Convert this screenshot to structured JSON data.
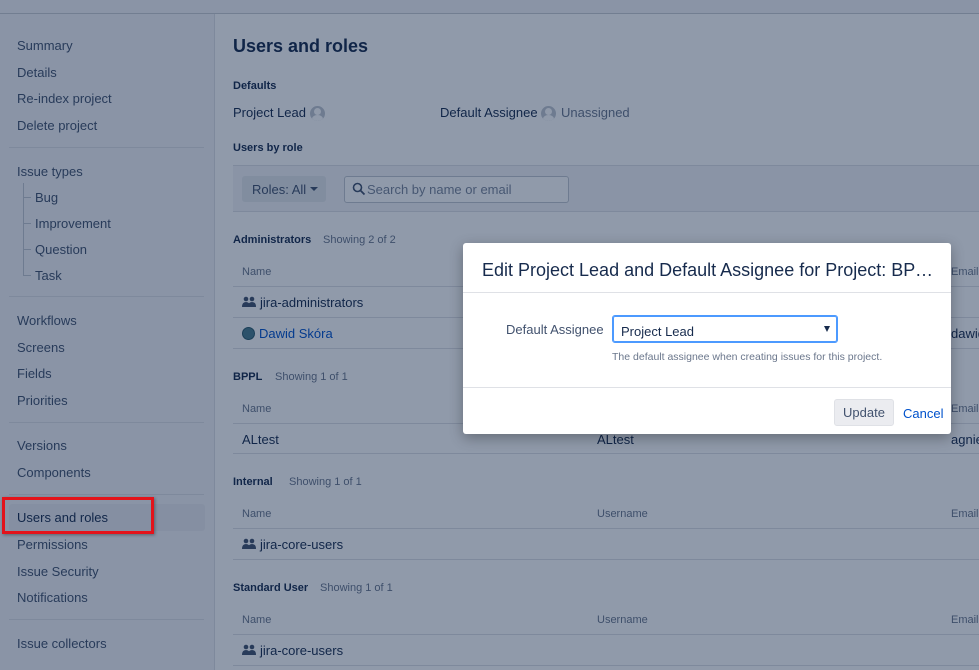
{
  "sidebar": {
    "project_items": [
      "Summary",
      "Details",
      "Re-index project",
      "Delete project"
    ],
    "issue_types_label": "Issue types",
    "issue_types": [
      "Bug",
      "Improvement",
      "Question",
      "Task"
    ],
    "workflow_items": [
      "Workflows",
      "Screens",
      "Fields",
      "Priorities"
    ],
    "version_items": [
      "Versions",
      "Components"
    ],
    "access_items": [
      "Users and roles",
      "Permissions",
      "Issue Security",
      "Notifications"
    ],
    "collector_items": [
      "Issue collectors"
    ],
    "selected": "Users and roles"
  },
  "main": {
    "title": "Users and roles",
    "defaults_heading": "Defaults",
    "project_lead_label": "Project Lead",
    "default_assignee_label": "Default Assignee",
    "default_assignee_value": "Unassigned",
    "users_by_role_heading": "Users by role",
    "roles_button": "Roles: All",
    "search_placeholder": "Search by name or email"
  },
  "sections": [
    {
      "name": "Administrators",
      "count": "Showing 2 of 2",
      "columns": [
        "Name",
        "",
        "Email"
      ],
      "rows": [
        {
          "type": "group",
          "name": "jira-administrators",
          "username": "",
          "email": ""
        },
        {
          "type": "user",
          "name": "Dawid Skóra",
          "username": "",
          "email": "dawid"
        }
      ]
    },
    {
      "name": "BPPL",
      "count": "Showing 1 of 1",
      "columns": [
        "Name",
        "",
        "Email"
      ],
      "rows": [
        {
          "type": "plain",
          "name": "ALtest",
          "username": "ALtest",
          "email": "agnie"
        }
      ]
    },
    {
      "name": "Internal",
      "count": "Showing 1 of 1",
      "columns": [
        "Name",
        "Username",
        "Email"
      ],
      "rows": [
        {
          "type": "group",
          "name": "jira-core-users",
          "username": "",
          "email": ""
        }
      ]
    },
    {
      "name": "Standard User",
      "count": "Showing 1 of 1",
      "columns": [
        "Name",
        "Username",
        "Email"
      ],
      "rows": [
        {
          "type": "group",
          "name": "jira-core-users",
          "username": "",
          "email": ""
        }
      ]
    }
  ],
  "dialog": {
    "title": "Edit Project Lead and Default Assignee for Project: BP Ex...",
    "field_label": "Default Assignee",
    "selected_value": "Project Lead",
    "help_text": "The default assignee when creating issues for this project.",
    "update_label": "Update",
    "cancel_label": "Cancel"
  },
  "colors": {
    "link": "#0052cc",
    "highlight": "#e3131b",
    "overlay": "#091e42"
  }
}
